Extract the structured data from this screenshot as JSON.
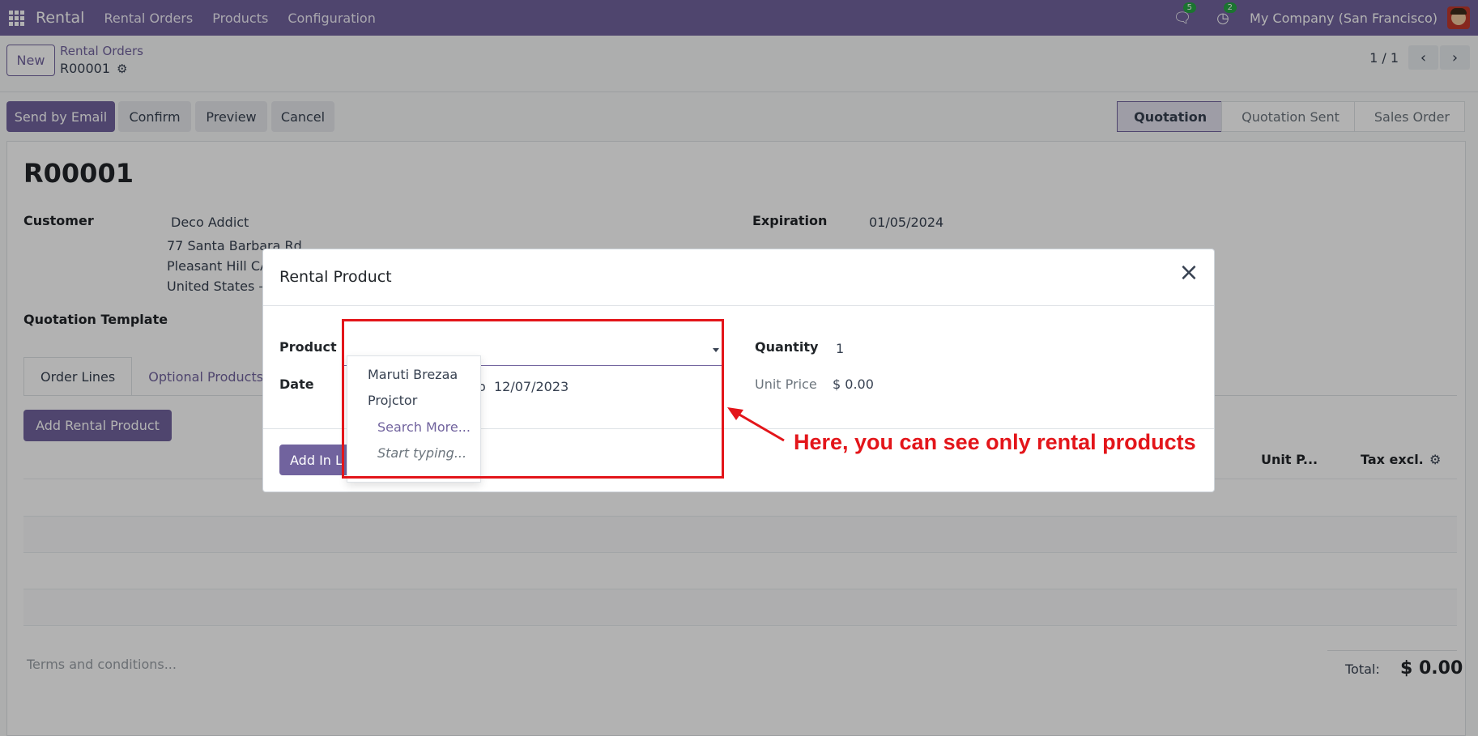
{
  "navbar": {
    "app_name": "Rental",
    "menu": [
      "Rental Orders",
      "Products",
      "Configuration"
    ],
    "messages_count": "5",
    "activities_count": "2",
    "company": "My Company (San Francisco)",
    "bg_color": "#71639e"
  },
  "control": {
    "new_label": "New",
    "breadcrumb_parent": "Rental Orders",
    "breadcrumb_current": "R00001",
    "pager_value": "1 / 1"
  },
  "actions": {
    "send_email": "Send by Email",
    "confirm": "Confirm",
    "preview": "Preview",
    "cancel": "Cancel"
  },
  "status": {
    "stages": [
      "Quotation",
      "Quotation Sent",
      "Sales Order"
    ],
    "active": "Quotation"
  },
  "form": {
    "title": "R00001",
    "customer_label": "Customer",
    "customer_name": "Deco Addict",
    "address_line1": "77 Santa Barbara Rd",
    "address_line2": "Pleasant Hill CA",
    "address_line3": "United States –",
    "expiration_label": "Expiration",
    "expiration_value": "01/05/2024",
    "quotation_template_label": "Quotation Template",
    "tabs": [
      "Order Lines",
      "Optional Products"
    ],
    "add_rental_product": "Add Rental Product",
    "columns": {
      "unit_price": "Unit P...",
      "tax_excl": "Tax excl."
    },
    "terms_placeholder": "Terms and conditions...",
    "total_label": "Total:",
    "total_value": "$ 0.00"
  },
  "modal": {
    "title": "Rental Product",
    "product_label": "Product",
    "product_value": "",
    "date_label": "Date",
    "date_value_partial": "o",
    "date_to": "12/07/2023",
    "quantity_label": "Quantity",
    "quantity_value": "1",
    "unit_price_label": "Unit Price",
    "unit_price_value": "$ 0.00",
    "add_in_line_label": "Add In L",
    "dropdown": {
      "items": [
        "Maruti Brezaa",
        "Projctor"
      ],
      "search_more": "Search More...",
      "hint": "Start typing..."
    }
  },
  "annotation": {
    "text": "Here, you can see only rental products",
    "color": "#e3151a"
  }
}
